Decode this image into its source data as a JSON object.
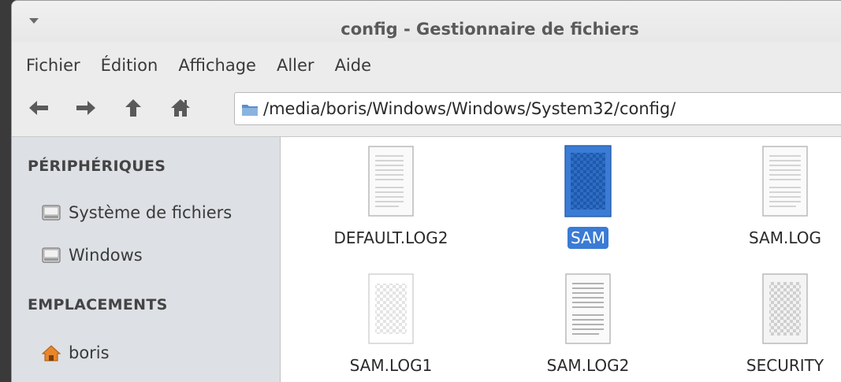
{
  "window": {
    "title": "config - Gestionnaire de fichiers"
  },
  "menubar": {
    "items": [
      "Fichier",
      "Édition",
      "Affichage",
      "Aller",
      "Aide"
    ]
  },
  "toolbar": {
    "back_icon": "back-arrow-icon",
    "forward_icon": "forward-arrow-icon",
    "up_icon": "up-arrow-icon",
    "home_icon": "home-icon",
    "path": "/media/boris/Windows/Windows/System32/config/"
  },
  "sidebar": {
    "devices_header": "PÉRIPHÉRIQUES",
    "devices": [
      {
        "label": "Système de fichiers",
        "icon": "drive-icon"
      },
      {
        "label": "Windows",
        "icon": "drive-icon"
      }
    ],
    "places_header": "EMPLACEMENTS",
    "places": [
      {
        "label": "boris",
        "icon": "home-icon"
      }
    ]
  },
  "files": [
    {
      "name": "DEFAULT.LOG2",
      "type": "text",
      "selected": false
    },
    {
      "name": "SAM",
      "type": "binary",
      "selected": true
    },
    {
      "name": "SAM.LOG",
      "type": "text",
      "selected": false
    },
    {
      "name": "SAM.LOG1",
      "type": "binary-empty",
      "selected": false
    },
    {
      "name": "SAM.LOG2",
      "type": "text",
      "selected": false
    },
    {
      "name": "SECURITY",
      "type": "binary",
      "selected": false
    }
  ],
  "colors": {
    "selection": "#3a7bd5",
    "sidebar_bg": "#dde0e4",
    "home_icon": "#e8862a"
  }
}
